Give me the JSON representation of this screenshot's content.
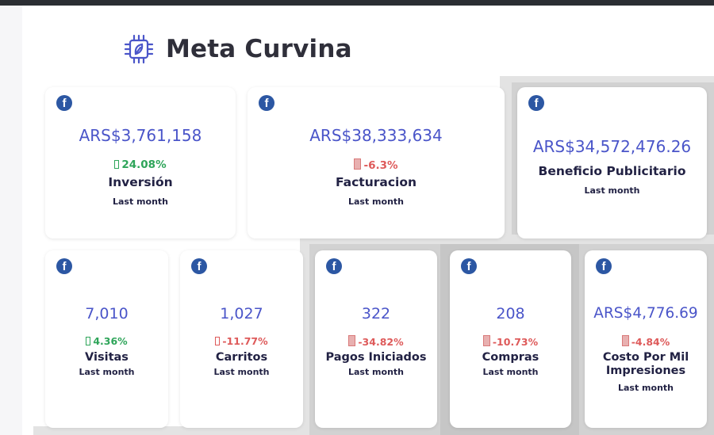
{
  "page": {
    "title": "Meta Curvina",
    "logo_icon": "cpu-chip-icon"
  },
  "colors": {
    "accent": "#4a55c9",
    "positive": "#2fa55a",
    "negative": "#de5a5a",
    "facebook": "#2c57a3"
  },
  "cards": [
    {
      "id": "inversion",
      "icon": "facebook-icon",
      "value": "ARS$3,761,158",
      "change": "24.08%",
      "trend": "up",
      "label": "Inversión",
      "period": "Last month"
    },
    {
      "id": "facturacion",
      "icon": "facebook-icon",
      "value": "ARS$38,333,634",
      "change": "-6.3%",
      "trend": "down",
      "label": "Facturacion",
      "period": "Last month"
    },
    {
      "id": "beneficio",
      "icon": "facebook-icon",
      "value": "ARS$34,572,476.26",
      "change": "",
      "trend": "",
      "label": "Beneficio Publicitario",
      "period": "Last month"
    },
    {
      "id": "visitas",
      "icon": "facebook-icon",
      "value": "7,010",
      "change": "4.36%",
      "trend": "up",
      "label": "Visitas",
      "period": "Last month"
    },
    {
      "id": "carritos",
      "icon": "facebook-icon",
      "value": "1,027",
      "change": "-11.77%",
      "trend": "down",
      "label": "Carritos",
      "period": "Last month"
    },
    {
      "id": "pagos",
      "icon": "facebook-icon",
      "value": "322",
      "change": "-34.82%",
      "trend": "down",
      "label": "Pagos Iniciados",
      "period": "Last month"
    },
    {
      "id": "compras",
      "icon": "facebook-icon",
      "value": "208",
      "change": "-10.73%",
      "trend": "down",
      "label": "Compras",
      "period": "Last month"
    },
    {
      "id": "cpm",
      "icon": "facebook-icon",
      "value": "ARS$4,776.69",
      "change": "-4.84%",
      "trend": "down",
      "label": "Costo Por Mil Impresiones",
      "period": "Last month"
    }
  ]
}
